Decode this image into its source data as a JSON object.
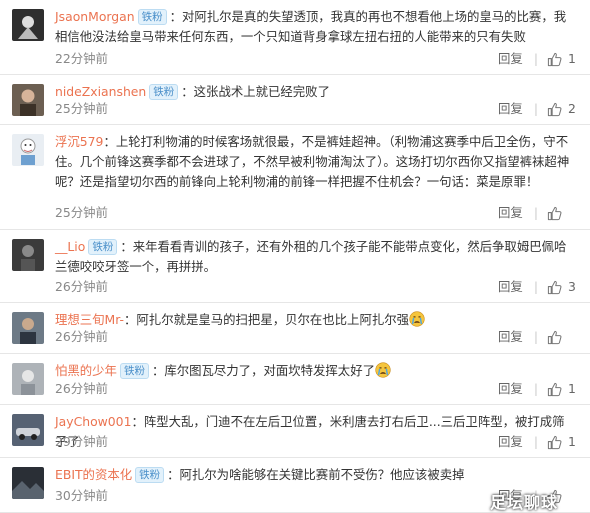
{
  "labels": {
    "reply": "回复"
  },
  "comments": [
    {
      "username": "JsaonMorgan",
      "badge": "铁粉",
      "text": "：对阿扎尔是真的失望透顶，我真的再也不想看他上场的皇马的比赛，我相信他没法给皇马带来任何东西，一个只知道背身拿球左扭右扭的人能带来的只有失败",
      "time": "22分钟前",
      "likes": "1",
      "avatar_icon": "avatar-dark-emblem-icon"
    },
    {
      "username": "nideZxianshen",
      "badge": "铁粉",
      "text": "：这张战术上就已经完败了",
      "time": "25分钟前",
      "likes": "2",
      "avatar_icon": "avatar-face-photo-icon"
    },
    {
      "username": "浮沉579",
      "badge": "",
      "text": "：上轮打利物浦的时候客场就很最，不是裤娃超神。（利物浦这赛季中后卫全伤，守不住。几个前锋这赛季都不会进球了，不然早被利物浦淘汰了）。这场打切尔西你又指望裤袜超神呢？还是指望切尔西的前锋向上轮利物浦的前锋一样把握不住机会？一句话：菜是原罪！",
      "time": "25分钟前",
      "likes": "",
      "avatar_icon": "avatar-cartoon-boy-icon"
    },
    {
      "username": "__Lio",
      "badge": "铁粉",
      "text": "：来年看看青训的孩子，还有外租的几个孩子能不能带点变化，然后争取姆巴佩哈兰德咬咬牙签一个，再拼拼。",
      "time": "26分钟前",
      "likes": "3",
      "avatar_icon": "avatar-dark-portrait-icon"
    },
    {
      "username": "理想三旬Mr-",
      "badge": "",
      "text": "：阿扎尔就是皇马的扫把星，贝尔在也比上阿扎尔强",
      "time": "26分钟前",
      "likes": "",
      "avatar_icon": "avatar-person-photo-icon",
      "emoji": "crying-face-emoji"
    },
    {
      "username": "怕黑的少年",
      "badge": "铁粉",
      "text": "：库尔图瓦尽力了，对面坎特发挥太好了",
      "time": "26分钟前",
      "likes": "1",
      "avatar_icon": "avatar-grey-figure-icon",
      "emoji": "crying-face-emoji"
    },
    {
      "username": "JayChow001",
      "badge": "",
      "text": "：阵型大乱，门迪不在左后卫位置，米利唐去打右后卫...三后卫阵型，被打成筛子了",
      "time": "29分钟前",
      "likes": "1",
      "avatar_icon": "avatar-car-photo-icon"
    },
    {
      "username": "EBIT的资本化",
      "badge": "铁粉",
      "text": "：阿扎尔为啥能够在关键比赛前不受伤？他应该被卖掉",
      "time": "30分钟前",
      "likes": "",
      "avatar_icon": "avatar-dark-landscape-icon"
    }
  ],
  "watermark": "足坛聊球"
}
